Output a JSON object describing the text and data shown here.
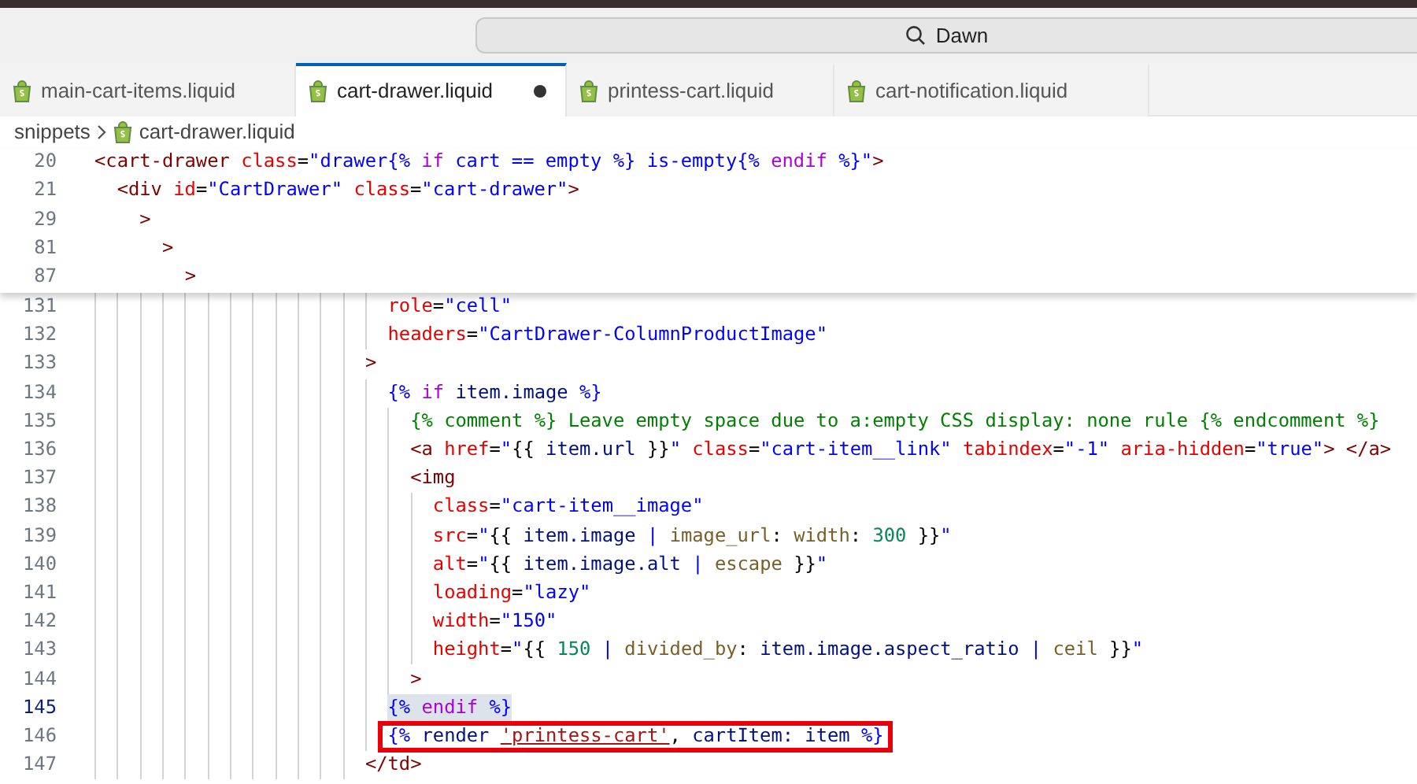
{
  "search": {
    "value": "Dawn"
  },
  "tabs": [
    {
      "label": "main-cart-items.liquid",
      "selected": false,
      "modified": false
    },
    {
      "label": "cart-drawer.liquid",
      "selected": true,
      "modified": true
    },
    {
      "label": "printess-cart.liquid",
      "selected": false,
      "modified": false
    },
    {
      "label": "cart-notification.liquid",
      "selected": false,
      "modified": false
    }
  ],
  "breadcrumb": {
    "folder": "snippets",
    "file": "cart-drawer.liquid"
  },
  "sticky_lines": [
    {
      "number": "20",
      "code": [
        {
          "kind": "tag",
          "text": "<cart-drawer"
        },
        {
          "kind": "attr",
          "text": " class"
        },
        {
          "kind": "text",
          "text": "="
        },
        {
          "kind": "str",
          "text": "\"drawer"
        },
        {
          "kind": "liq",
          "text": "{% "
        },
        {
          "kind": "kw",
          "text": "if"
        },
        {
          "kind": "str",
          "text": " cart == empty "
        },
        {
          "kind": "liq",
          "text": "%}"
        },
        {
          "kind": "str",
          "text": " is-empty"
        },
        {
          "kind": "liq",
          "text": "{% "
        },
        {
          "kind": "kw",
          "text": "endif"
        },
        {
          "kind": "liq",
          "text": " %}"
        },
        {
          "kind": "str",
          "text": "\""
        },
        {
          "kind": "tag",
          "text": ">"
        }
      ]
    },
    {
      "number": "21",
      "code": [
        {
          "kind": "tag",
          "text": "  <div"
        },
        {
          "kind": "attr",
          "text": " id"
        },
        {
          "kind": "text",
          "text": "="
        },
        {
          "kind": "str",
          "text": "\"CartDrawer\""
        },
        {
          "kind": "attr",
          "text": " class"
        },
        {
          "kind": "text",
          "text": "="
        },
        {
          "kind": "str",
          "text": "\"cart-drawer\""
        },
        {
          "kind": "tag",
          "text": ">"
        }
      ]
    },
    {
      "number": "29",
      "code": [
        {
          "kind": "tag",
          "text": "    >"
        }
      ]
    },
    {
      "number": "81",
      "code": [
        {
          "kind": "tag",
          "text": "      >"
        }
      ]
    },
    {
      "number": "87",
      "code": [
        {
          "kind": "tag",
          "text": "        >"
        }
      ]
    }
  ],
  "lines": [
    {
      "number": "131",
      "current": false,
      "kind": "plain",
      "code": [
        {
          "kind": "attr",
          "text": "                          role"
        },
        {
          "kind": "text",
          "text": "="
        },
        {
          "kind": "str",
          "text": "\"cell\""
        }
      ]
    },
    {
      "number": "132",
      "current": false,
      "kind": "plain",
      "code": [
        {
          "kind": "attr",
          "text": "                          headers"
        },
        {
          "kind": "text",
          "text": "="
        },
        {
          "kind": "str",
          "text": "\"CartDrawer-ColumnProductImage\""
        }
      ]
    },
    {
      "number": "133",
      "current": false,
      "kind": "plain",
      "code": [
        {
          "kind": "tag",
          "text": "                        >"
        }
      ]
    },
    {
      "number": "134",
      "current": false,
      "kind": "plain",
      "code": [
        {
          "kind": "liq",
          "text": "                          {% "
        },
        {
          "kind": "kw",
          "text": "if"
        },
        {
          "kind": "var",
          "text": " item.image "
        },
        {
          "kind": "liq",
          "text": "%}"
        }
      ]
    },
    {
      "number": "135",
      "current": false,
      "kind": "plain",
      "code": [
        {
          "kind": "cmt",
          "text": "                            {% comment %} Leave empty space due to a:empty CSS display: none rule {% endcomment %}"
        }
      ]
    },
    {
      "number": "136",
      "current": false,
      "kind": "plain",
      "code": [
        {
          "kind": "tag",
          "text": "                            <a"
        },
        {
          "kind": "attr",
          "text": " href"
        },
        {
          "kind": "text",
          "text": "="
        },
        {
          "kind": "str",
          "text": "\""
        },
        {
          "kind": "text",
          "text": "{{ "
        },
        {
          "kind": "var",
          "text": "item.url"
        },
        {
          "kind": "text",
          "text": " }}"
        },
        {
          "kind": "str",
          "text": "\""
        },
        {
          "kind": "attr",
          "text": " class"
        },
        {
          "kind": "text",
          "text": "="
        },
        {
          "kind": "str",
          "text": "\"cart-item__link\""
        },
        {
          "kind": "attr",
          "text": " tabindex"
        },
        {
          "kind": "text",
          "text": "="
        },
        {
          "kind": "str",
          "text": "\"-1\""
        },
        {
          "kind": "attr",
          "text": " aria-hidden"
        },
        {
          "kind": "text",
          "text": "="
        },
        {
          "kind": "str",
          "text": "\"true\""
        },
        {
          "kind": "tag",
          "text": ">"
        },
        {
          "kind": "tag",
          "text": " </a>"
        }
      ]
    },
    {
      "number": "137",
      "current": false,
      "kind": "plain",
      "code": [
        {
          "kind": "tag",
          "text": "                            <img"
        }
      ]
    },
    {
      "number": "138",
      "current": false,
      "kind": "plain",
      "code": [
        {
          "kind": "attr",
          "text": "                              class"
        },
        {
          "kind": "text",
          "text": "="
        },
        {
          "kind": "str",
          "text": "\"cart-item__image\""
        }
      ]
    },
    {
      "number": "139",
      "current": false,
      "kind": "plain",
      "code": [
        {
          "kind": "attr",
          "text": "                              src"
        },
        {
          "kind": "text",
          "text": "="
        },
        {
          "kind": "str",
          "text": "\""
        },
        {
          "kind": "text",
          "text": "{{ "
        },
        {
          "kind": "var",
          "text": "item.image "
        },
        {
          "kind": "liq",
          "text": "|"
        },
        {
          "kind": "fn",
          "text": " image_url"
        },
        {
          "kind": "text",
          "text": ": "
        },
        {
          "kind": "fn",
          "text": "width"
        },
        {
          "kind": "text",
          "text": ": "
        },
        {
          "kind": "num",
          "text": "300"
        },
        {
          "kind": "text",
          "text": " }}"
        },
        {
          "kind": "str",
          "text": "\""
        }
      ]
    },
    {
      "number": "140",
      "current": false,
      "kind": "plain",
      "code": [
        {
          "kind": "attr",
          "text": "                              alt"
        },
        {
          "kind": "text",
          "text": "="
        },
        {
          "kind": "str",
          "text": "\""
        },
        {
          "kind": "text",
          "text": "{{ "
        },
        {
          "kind": "var",
          "text": "item.image.alt "
        },
        {
          "kind": "liq",
          "text": "|"
        },
        {
          "kind": "fn",
          "text": " escape"
        },
        {
          "kind": "text",
          "text": " }}"
        },
        {
          "kind": "str",
          "text": "\""
        }
      ]
    },
    {
      "number": "141",
      "current": false,
      "kind": "plain",
      "code": [
        {
          "kind": "attr",
          "text": "                              loading"
        },
        {
          "kind": "text",
          "text": "="
        },
        {
          "kind": "str",
          "text": "\"lazy\""
        }
      ]
    },
    {
      "number": "142",
      "current": false,
      "kind": "plain",
      "code": [
        {
          "kind": "attr",
          "text": "                              width"
        },
        {
          "kind": "text",
          "text": "="
        },
        {
          "kind": "str",
          "text": "\"150\""
        }
      ]
    },
    {
      "number": "143",
      "current": false,
      "kind": "plain",
      "code": [
        {
          "kind": "attr",
          "text": "                              height"
        },
        {
          "kind": "text",
          "text": "="
        },
        {
          "kind": "str",
          "text": "\""
        },
        {
          "kind": "text",
          "text": "{{ "
        },
        {
          "kind": "num",
          "text": "150 "
        },
        {
          "kind": "liq",
          "text": "|"
        },
        {
          "kind": "fn",
          "text": " divided_by"
        },
        {
          "kind": "text",
          "text": ": "
        },
        {
          "kind": "var",
          "text": "item.image.aspect_ratio "
        },
        {
          "kind": "liq",
          "text": "|"
        },
        {
          "kind": "fn",
          "text": " ceil"
        },
        {
          "kind": "text",
          "text": " }}"
        },
        {
          "kind": "str",
          "text": "\""
        }
      ]
    },
    {
      "number": "144",
      "current": false,
      "kind": "plain",
      "code": [
        {
          "kind": "tag",
          "text": "                            >"
        }
      ]
    },
    {
      "number": "145",
      "current": true,
      "kind": "highlighted",
      "code": [
        {
          "kind": "liq",
          "text": "                          {% "
        },
        {
          "kind": "kw",
          "text": "endif"
        },
        {
          "kind": "liq",
          "text": " %}"
        }
      ]
    },
    {
      "number": "146",
      "current": false,
      "kind": "boxed",
      "code": [
        {
          "kind": "liq",
          "text": "                          {% "
        },
        {
          "kind": "var",
          "text": "render "
        },
        {
          "kind": "link",
          "text": "'printess-cart'"
        },
        {
          "kind": "text",
          "text": ", "
        },
        {
          "kind": "var",
          "text": "cartItem: item "
        },
        {
          "kind": "liq",
          "text": "%}"
        }
      ]
    },
    {
      "number": "147",
      "current": false,
      "kind": "plain",
      "code": [
        {
          "kind": "tag",
          "text": "                        </td>"
        }
      ]
    }
  ]
}
